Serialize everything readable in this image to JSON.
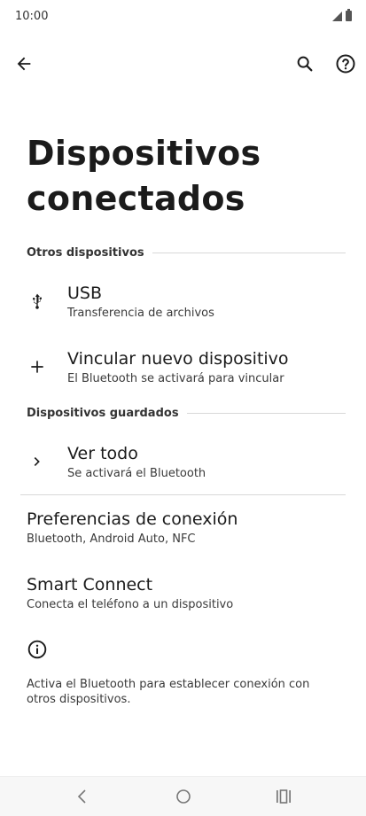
{
  "status": {
    "time": "10:00"
  },
  "header": {
    "title": "Dispositivos conectados"
  },
  "sections": {
    "other": "Otros dispositivos",
    "saved": "Dispositivos guardados"
  },
  "rows": {
    "usb": {
      "title": "USB",
      "subtitle": "Transferencia de archivos"
    },
    "pair": {
      "title": "Vincular nuevo dispositivo",
      "subtitle": "El Bluetooth se activará para vincular"
    },
    "see_all": {
      "title": "Ver todo",
      "subtitle": "Se activará el Bluetooth"
    },
    "prefs": {
      "title": "Preferencias de conexión",
      "subtitle": "Bluetooth, Android Auto, NFC"
    },
    "smart": {
      "title": "Smart Connect",
      "subtitle": "Conecta el teléfono a un dispositivo"
    }
  },
  "footer": {
    "info": "Activa el Bluetooth para establecer conexión con otros dispositivos."
  },
  "icons": {
    "back": "back-arrow-icon",
    "search": "search-icon",
    "help": "help-icon",
    "usb": "usb-icon",
    "add": "plus-icon",
    "chevron": "chevron-right-icon",
    "info": "info-icon"
  }
}
